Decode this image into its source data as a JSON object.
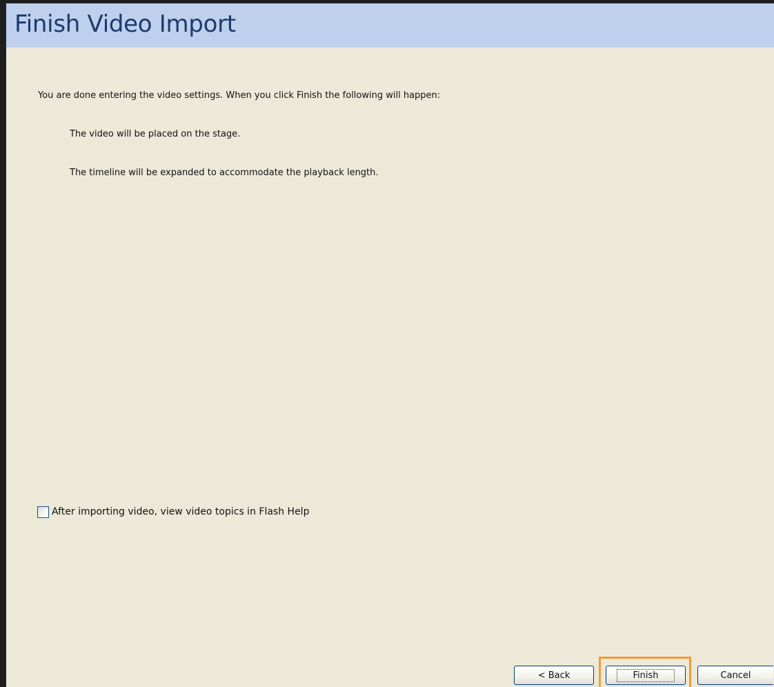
{
  "header": {
    "title": "Finish Video Import"
  },
  "content": {
    "intro": "You are done entering the video settings. When you click Finish the following will happen:",
    "bullets": [
      "The video will be placed on the stage.",
      "The timeline will be expanded to accommodate the playback length."
    ]
  },
  "help_option": {
    "label": "After importing video, view video topics in Flash Help",
    "checked": false
  },
  "buttons": {
    "back_label": "< Back",
    "finish_label": "Finish",
    "cancel_label": "Cancel"
  },
  "colors": {
    "dialog_background": "#ece9d8",
    "header_background": "#bed0ec",
    "title_text": "#1c3a6e",
    "focus_highlight": "#f39c34"
  }
}
